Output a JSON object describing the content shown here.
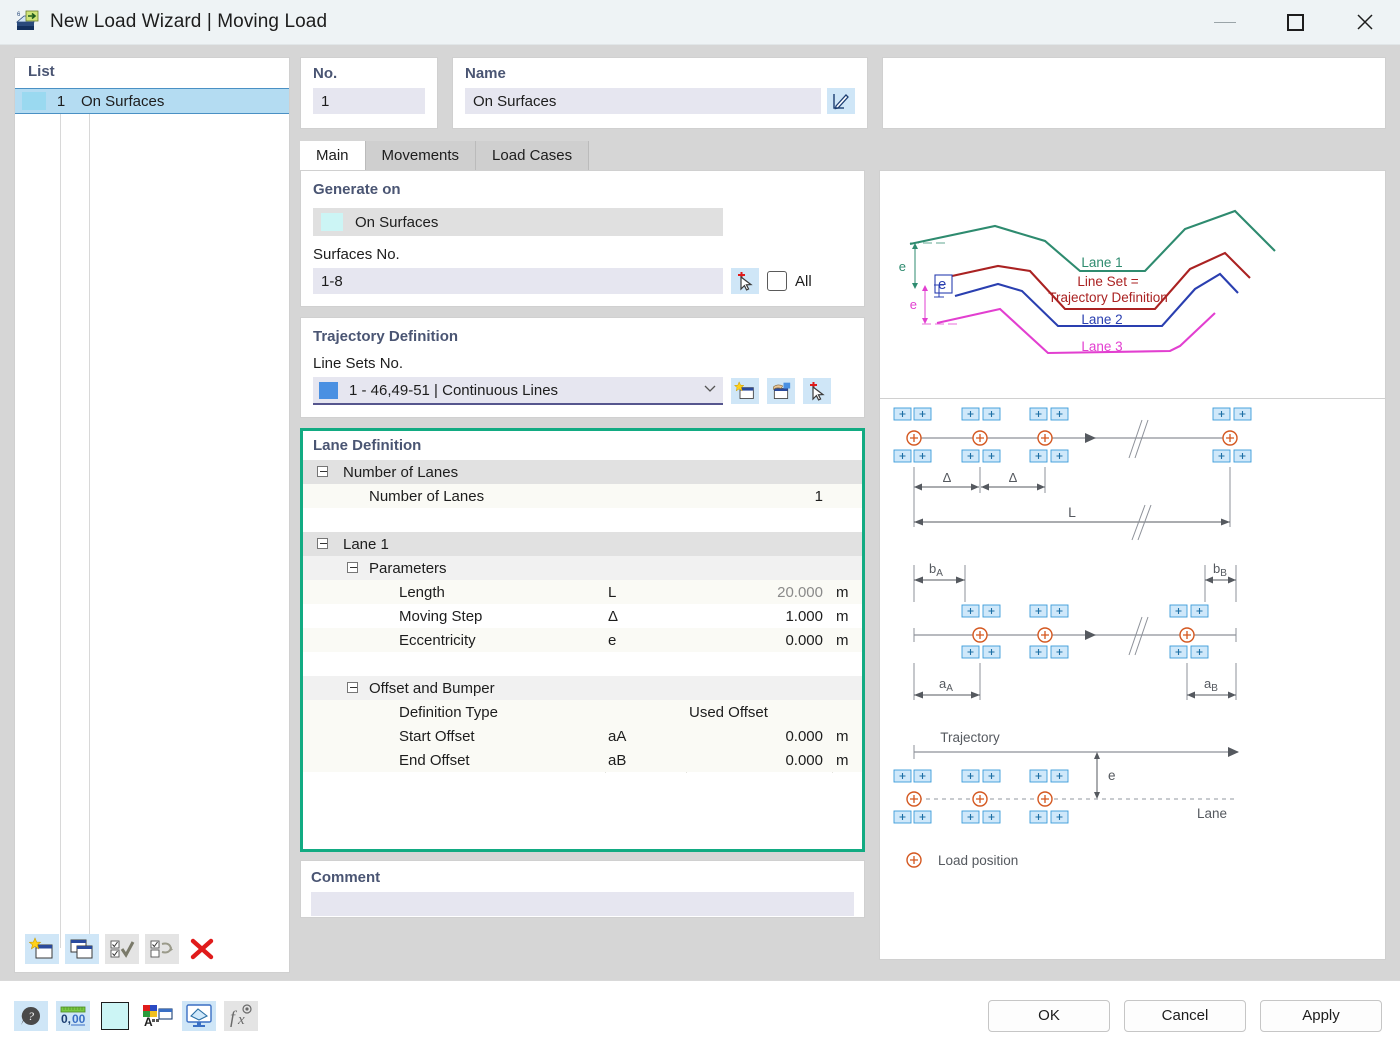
{
  "window": {
    "title": "New Load Wizard | Moving Load",
    "icon": "moving-load-icon",
    "minimize": "—",
    "maximize": "□",
    "close": "✕"
  },
  "list_panel": {
    "header": "List",
    "rows": [
      {
        "number": "1",
        "label": "On Surfaces",
        "color": "#9ad9f0"
      }
    ],
    "toolbar": [
      {
        "name": "new-item-icon"
      },
      {
        "name": "copy-item-icon"
      },
      {
        "name": "select-all-icon"
      },
      {
        "name": "invert-selection-icon"
      },
      {
        "name": "delete-item-icon"
      }
    ]
  },
  "header_fields": {
    "no_label": "No.",
    "no_value": "1",
    "name_label": "Name",
    "name_value": "On Surfaces",
    "name_edit_icon": "edit-pencil-icon"
  },
  "tabs": [
    {
      "label": "Main",
      "active": true
    },
    {
      "label": "Movements",
      "active": false
    },
    {
      "label": "Load Cases",
      "active": false
    }
  ],
  "generate_on": {
    "title": "Generate on",
    "selected": "On Surfaces",
    "selected_color": "#ccf5f5",
    "surfaces_label": "Surfaces No.",
    "surfaces_value": "1-8",
    "pick_icon": "pick-with-cursor-icon",
    "all_checkbox_label": "All",
    "all_checked": false
  },
  "trajectory": {
    "title": "Trajectory Definition",
    "line_sets_label": "Line Sets No.",
    "line_sets_value": "1 - 46,49-51 | Continuous Lines",
    "line_sets_color": "#4a90e2",
    "buttons": [
      {
        "name": "new-line-set-icon"
      },
      {
        "name": "edit-line-set-icon"
      },
      {
        "name": "pick-line-set-icon"
      }
    ]
  },
  "lane_definition": {
    "title": "Lane Definition",
    "highlight_color": "#12ab82",
    "groups": [
      {
        "name": "Number of Lanes",
        "rows": [
          {
            "label": "Number of Lanes",
            "symbol": "",
            "value": "1",
            "unit": "",
            "dim": false
          }
        ]
      },
      {
        "name": "Lane 1",
        "subgroups": [
          {
            "name": "Parameters",
            "rows": [
              {
                "label": "Length",
                "symbol": "L",
                "value": "20.000",
                "unit": "m",
                "dim": true
              },
              {
                "label": "Moving Step",
                "symbol": "Δ",
                "value": "1.000",
                "unit": "m",
                "dim": false
              },
              {
                "label": "Eccentricity",
                "symbol": "e",
                "value": "0.000",
                "unit": "m",
                "dim": false
              }
            ]
          },
          {
            "name": "Offset and Bumper",
            "rows": [
              {
                "label": "Definition Type",
                "symbol": "",
                "value": "Used Offset",
                "unit": "",
                "dim": false,
                "left_align": true
              },
              {
                "label": "Start Offset",
                "symbol": "aA",
                "value": "0.000",
                "unit": "m",
                "dim": false
              },
              {
                "label": "End Offset",
                "symbol": "aB",
                "value": "0.000",
                "unit": "m",
                "dim": false
              }
            ]
          }
        ]
      }
    ]
  },
  "comment": {
    "title": "Comment",
    "value": ""
  },
  "diagram_top": {
    "lane1": "Lane 1",
    "lane2": "Lane 2",
    "lane3": "Lane 3",
    "lineset_label_1": "Line Set =",
    "lineset_label_2": "Trajectory Definition",
    "ecc_labels": [
      "e",
      "e",
      "e"
    ],
    "colors": {
      "lane1": "#2e8b6f",
      "lane2": "#2a3fb0",
      "lane3": "#e23fd0",
      "lineset": "#aa2222"
    }
  },
  "diagram_bottom": {
    "delta_label": "Δ",
    "length_label": "L",
    "bA": "b",
    "bA_sub": "A",
    "bB": "b",
    "bB_sub": "B",
    "aA": "a",
    "aA_sub": "A",
    "aB": "a",
    "aB_sub": "B",
    "trajectory_label": "Trajectory",
    "eccentricity_label": "e",
    "lane_label": "Lane",
    "legend_label": "Load position"
  },
  "footer": {
    "tools": [
      {
        "name": "help-icon"
      },
      {
        "name": "units-decimal-icon"
      },
      {
        "name": "color-swatch-icon"
      },
      {
        "name": "display-properties-icon"
      },
      {
        "name": "view-settings-icon"
      },
      {
        "name": "formula-icon"
      }
    ],
    "buttons": [
      {
        "label": "OK",
        "name": "ok-button"
      },
      {
        "label": "Cancel",
        "name": "cancel-button"
      },
      {
        "label": "Apply",
        "name": "apply-button"
      }
    ]
  }
}
